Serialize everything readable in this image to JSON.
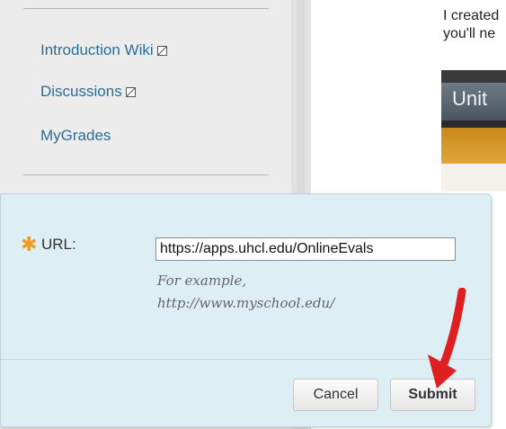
{
  "course_menu": {
    "items": [
      {
        "label": "Introduction Wiki",
        "hidden_icon": "hidden-from-students-icon"
      },
      {
        "label": "Discussions",
        "hidden_icon": "hidden-from-students-icon"
      },
      {
        "label": "MyGrades"
      }
    ]
  },
  "content": {
    "lines": [
      "I created",
      "you'll ne"
    ],
    "thumbnail_title": "Unit"
  },
  "dialog": {
    "required_icon": "asterisk-required-icon",
    "url_label": "URL:",
    "url_value": "https://apps.uhcl.edu/OnlineEvals",
    "hint_line1": "For example,",
    "hint_line2": "http://www.myschool.edu/",
    "cancel_label": "Cancel",
    "submit_label": "Submit",
    "accent_color": "#f39a1c",
    "arrow_color": "#e02020"
  }
}
